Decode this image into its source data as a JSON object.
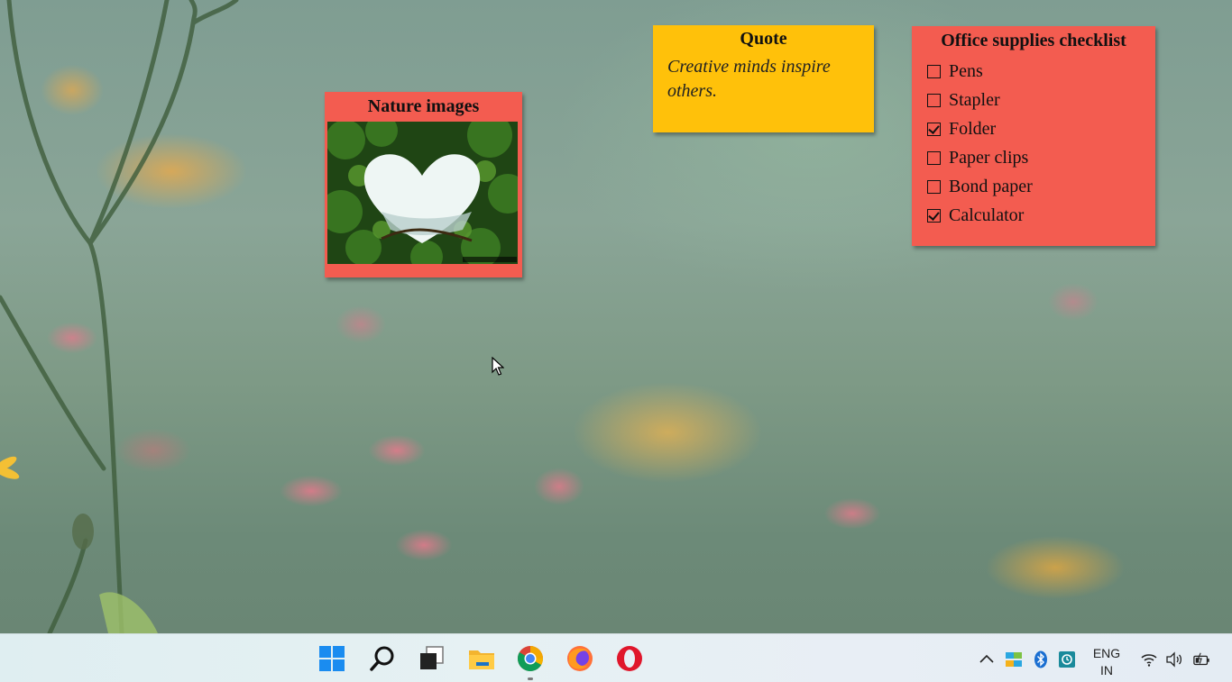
{
  "notes": {
    "nature": {
      "title": "Nature images",
      "image_alt": "Heart-shaped opening in green forest foliage"
    },
    "quote": {
      "title": "Quote",
      "text": "Creative minds inspire others."
    },
    "checklist": {
      "title": "Office supplies checklist",
      "items": [
        {
          "label": "Pens",
          "checked": false
        },
        {
          "label": "Stapler",
          "checked": false
        },
        {
          "label": "Folder",
          "checked": true
        },
        {
          "label": "Paper clips",
          "checked": false
        },
        {
          "label": "Bond paper",
          "checked": false
        },
        {
          "label": "Calculator",
          "checked": true
        }
      ]
    }
  },
  "taskbar": {
    "apps": [
      {
        "name": "start",
        "icon": "windows-logo-icon"
      },
      {
        "name": "search",
        "icon": "search-icon"
      },
      {
        "name": "task-view",
        "icon": "task-view-icon"
      },
      {
        "name": "file-explorer",
        "icon": "folder-icon"
      },
      {
        "name": "chrome",
        "icon": "chrome-icon"
      },
      {
        "name": "firefox",
        "icon": "firefox-icon"
      },
      {
        "name": "opera",
        "icon": "opera-icon"
      }
    ],
    "tray": {
      "language_line1": "ENG",
      "language_line2": "IN",
      "icons": [
        "chevron-up-icon",
        "network-apps-icon",
        "bluetooth-icon",
        "sync-icon",
        "wifi-icon",
        "volume-icon",
        "battery-icon"
      ]
    }
  },
  "colors": {
    "note_red": "#f35c50",
    "note_yellow": "#ffc10a"
  }
}
